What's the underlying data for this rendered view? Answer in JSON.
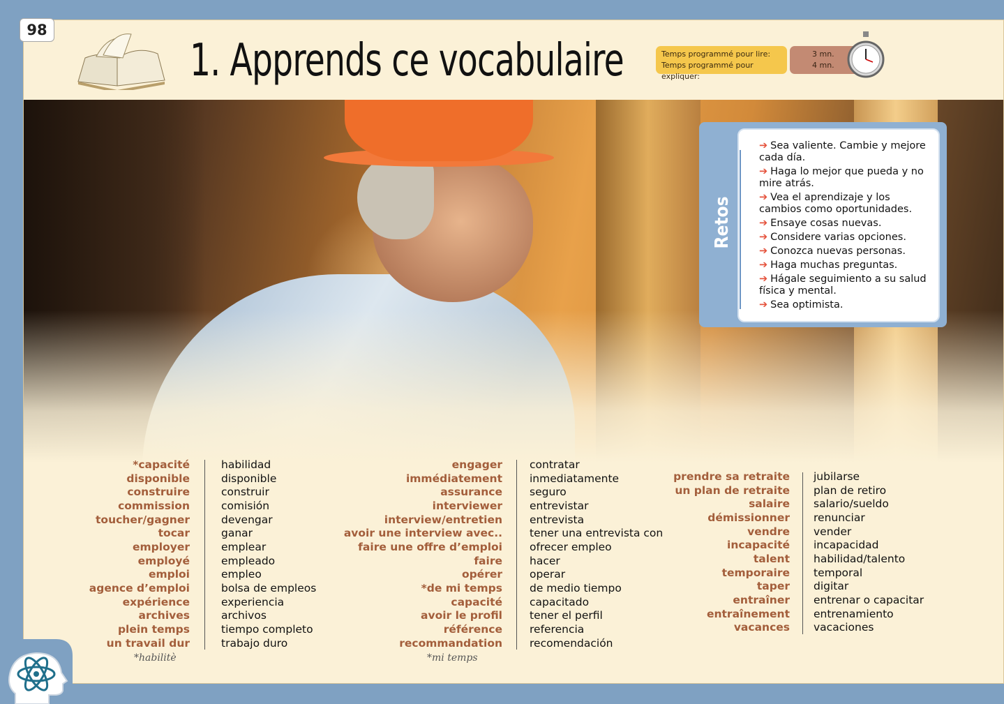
{
  "page_number": "98",
  "title": "1. Apprends ce vocabulaire",
  "timing": {
    "read_label": "Temps programmé pour lire:",
    "explain_label": "Temps programmé pour expliquer:",
    "read_value": "3 mn.",
    "explain_value": "4 mn."
  },
  "retos": {
    "label": "Retos",
    "items": [
      "Sea valiente. Cambie y mejore cada día.",
      "Haga lo mejor que pueda y no mire atrás.",
      "Vea  el aprendizaje y los cambios como oportunidades.",
      "Ensaye cosas nuevas.",
      "Considere varias opciones.",
      "Conozca nuevas personas.",
      "Haga muchas preguntas.",
      "Hágale seguimiento a su salud física y mental.",
      "Sea optimista."
    ]
  },
  "vocab_columns": [
    {
      "fr": [
        "*capacité",
        "disponible",
        "construire",
        "commission",
        "toucher/gagner",
        "tocar",
        "employer",
        "employé",
        "emploi",
        "agence d’emploi",
        "expérience",
        "archives",
        "plein temps",
        "un travail dur"
      ],
      "es": [
        "habilidad",
        "disponible",
        "construir",
        "comisión",
        "devengar",
        "ganar",
        "emplear",
        "empleado",
        "empleo",
        "bolsa de empleos",
        "experiencia",
        "archivos",
        "tiempo completo",
        "trabajo duro"
      ],
      "footnote": "*habilitè"
    },
    {
      "fr": [
        "engager",
        "immédiatement",
        "assurance",
        "interviewer",
        "interview/entretien",
        "avoir une interview avec..",
        "faire une offre d’emploi",
        "faire",
        "opérer",
        "*de mi temps",
        "capacité",
        "avoir le profil",
        "référence",
        "recommandation"
      ],
      "es": [
        "contratar",
        "inmediatamente",
        "seguro",
        "entrevistar",
        "entrevista",
        "tener una entrevista con",
        "ofrecer empleo",
        "hacer",
        "operar",
        "de medio tiempo",
        "capacitado",
        "tener el perfil",
        "referencia",
        "recomendación"
      ],
      "footnote": "*mi temps"
    },
    {
      "fr": [
        "prendre sa retraite",
        "un plan de retraite",
        "salaire",
        "démissionner",
        "vendre",
        "incapacité",
        "talent",
        "temporaire",
        "taper",
        "entraîner",
        "entraînement",
        "vacances"
      ],
      "es": [
        "jubilarse",
        "plan de retiro",
        "salario/sueldo",
        "renunciar",
        "vender",
        "incapacidad",
        "habilidad/talento",
        "temporal",
        "digitar",
        "entrenar o capacitar",
        "entrenamiento",
        "vacaciones"
      ],
      "footnote": ""
    }
  ],
  "colors": {
    "frame": "#7fa1c2",
    "page": "#fbf1d7",
    "french_term": "#a35e3b",
    "timer_box": "#f5c74c",
    "timer_value": "#c38a73",
    "retos_blue": "#8fb0d2",
    "bullet_arrow": "#e5533d"
  },
  "icons": [
    "open-book-icon",
    "stopwatch-icon",
    "head-atom-icon",
    "arrow-bullet-icon"
  ]
}
